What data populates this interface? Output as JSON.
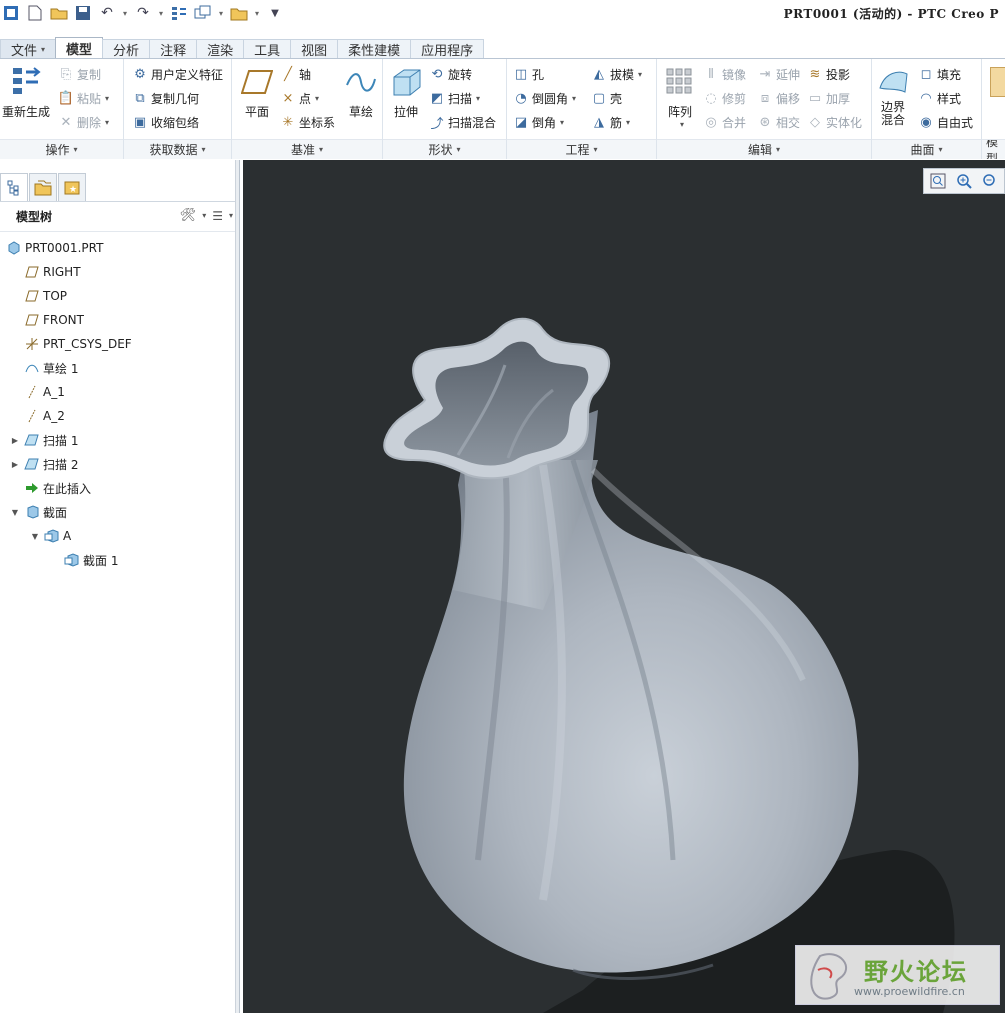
{
  "window": {
    "title": "PRT0001 (活动的) - PTC Creo P"
  },
  "quick_access": [
    "app-icon",
    "new-icon",
    "open-icon",
    "save-icon",
    "undo-icon",
    "redo-icon",
    "regenerate-icon",
    "windows-icon",
    "close-icon"
  ],
  "tabs": [
    {
      "label": "文件",
      "dropdown": "▾"
    },
    {
      "label": "模型"
    },
    {
      "label": "分析"
    },
    {
      "label": "注释"
    },
    {
      "label": "渲染"
    },
    {
      "label": "工具"
    },
    {
      "label": "视图"
    },
    {
      "label": "柔性建模"
    },
    {
      "label": "应用程序"
    }
  ],
  "ribbon": {
    "operations": {
      "group": "操作",
      "regenerate": "重新生成",
      "copy": "复制",
      "paste": "粘贴",
      "delete": "删除"
    },
    "get_data": {
      "group": "获取数据",
      "udf": "用户定义特征",
      "copy_geom": "复制几何",
      "shrinkwrap": "收缩包络"
    },
    "datum": {
      "group": "基准",
      "plane": "平面",
      "axis": "轴",
      "point": "点",
      "csys": "坐标系",
      "sketch": "草绘"
    },
    "shapes": {
      "group": "形状",
      "extrude": "拉伸",
      "revolve": "旋转",
      "sweep": "扫描",
      "swept_blend": "扫描混合"
    },
    "engineering": {
      "group": "工程",
      "hole": "孔",
      "round": "倒圆角",
      "chamfer": "倒角",
      "draft": "拔模",
      "shell": "壳",
      "rib": "筋"
    },
    "editing": {
      "group": "编辑",
      "pattern": "阵列",
      "mirror": "镜像",
      "extend": "延伸",
      "project": "投影",
      "trim": "修剪",
      "offset": "偏移",
      "thicken": "加厚",
      "merge": "合并",
      "intersect": "相交",
      "solidify": "实体化"
    },
    "surfaces": {
      "group": "曲面",
      "boundary_blend": "边界混合",
      "fill": "填充",
      "style": "样式",
      "freestyle": "自由式"
    },
    "more": {
      "group": "模型"
    }
  },
  "model_tree": {
    "title": "模型树",
    "items": [
      {
        "label": "PRT0001.PRT",
        "icon": "part-icon",
        "level": 0,
        "expander": ""
      },
      {
        "label": "RIGHT",
        "icon": "datum-plane-icon",
        "level": 1,
        "expander": ""
      },
      {
        "label": "TOP",
        "icon": "datum-plane-icon",
        "level": 1,
        "expander": ""
      },
      {
        "label": "FRONT",
        "icon": "datum-plane-icon",
        "level": 1,
        "expander": ""
      },
      {
        "label": "PRT_CSYS_DEF",
        "icon": "csys-icon",
        "level": 1,
        "expander": ""
      },
      {
        "label": "草绘 1",
        "icon": "sketch-icon",
        "level": 1,
        "expander": ""
      },
      {
        "label": "A_1",
        "icon": "datum-axis-icon",
        "level": 1,
        "expander": ""
      },
      {
        "label": "A_2",
        "icon": "datum-axis-icon",
        "level": 1,
        "expander": ""
      },
      {
        "label": "扫描 1",
        "icon": "sweep-icon",
        "level": 1,
        "expander": "▶"
      },
      {
        "label": "扫描 2",
        "icon": "sweep-icon",
        "level": 1,
        "expander": "▶"
      },
      {
        "label": "在此插入",
        "icon": "insert-here-icon",
        "level": 1,
        "expander": ""
      },
      {
        "label": "截面",
        "icon": "section-folder-icon",
        "level": 1,
        "expander": "▼"
      },
      {
        "label": "A",
        "icon": "section-icon",
        "level": 2,
        "expander": "▼"
      },
      {
        "label": "截面 1",
        "icon": "section-icon",
        "level": 3,
        "expander": ""
      }
    ]
  },
  "viewport": {
    "tools": [
      "refit-icon",
      "zoom-in-icon",
      "zoom-out-icon"
    ]
  },
  "watermark": {
    "name": "野火论坛",
    "url": "www.proewildfire.cn"
  }
}
